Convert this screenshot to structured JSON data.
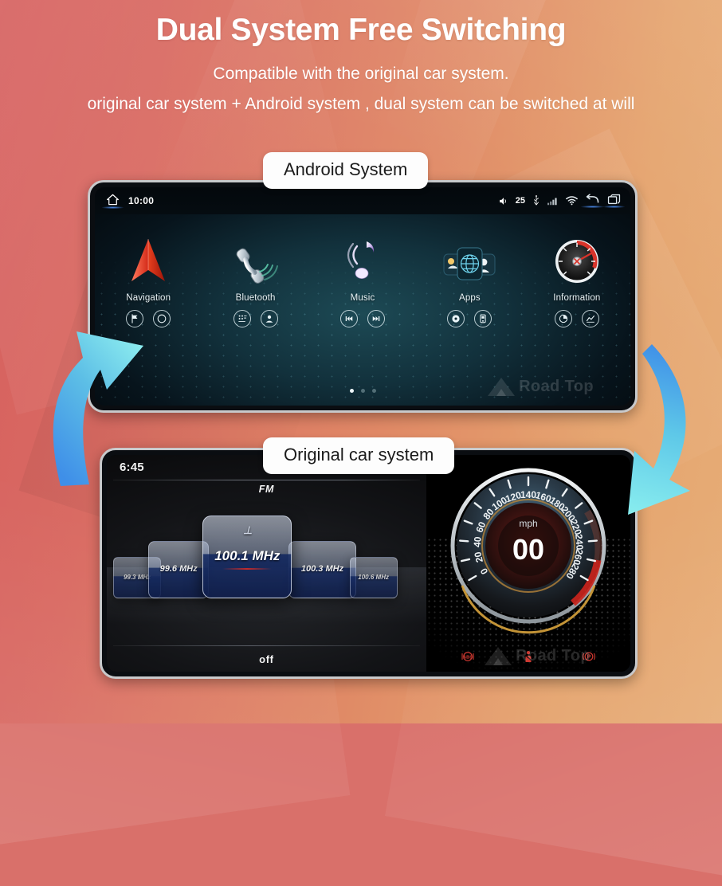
{
  "header": {
    "title": "Dual System Free Switching",
    "subtitle_1": "Compatible with the original car system.",
    "subtitle_2": "original car system + Android system , dual system can be switched at will"
  },
  "badges": {
    "android": "Android System",
    "original": "Original car system"
  },
  "android_screen": {
    "statusbar": {
      "home_icon": "home-icon",
      "time": "10:00",
      "volume": "25",
      "usb_icon": "usb-icon",
      "signal_icon": "signal-bars-icon",
      "wifi_icon": "wifi-icon",
      "back_icon": "back-arrow-icon",
      "recents_icon": "recent-apps-icon"
    },
    "apps": [
      {
        "label": "Navigation",
        "icon": "navigation-arrow-icon",
        "buttons": [
          "route-flag-icon",
          "map-pin-icon"
        ]
      },
      {
        "label": "Bluetooth",
        "icon": "phone-handset-icon",
        "buttons": [
          "dialpad-icon",
          "contact-icon"
        ]
      },
      {
        "label": "Music",
        "icon": "music-note-icon",
        "buttons": [
          "previous-track-icon",
          "next-track-icon"
        ]
      },
      {
        "label": "Apps",
        "icon": "app-tiles-globe-icon",
        "buttons": [
          "record-icon",
          "device-icon"
        ]
      },
      {
        "label": "Information",
        "icon": "gauge-icon",
        "buttons": [
          "pie-chart-icon",
          "chart-icon"
        ]
      }
    ],
    "page_dots": {
      "total": 3,
      "active": 1
    },
    "watermark": "Road Top"
  },
  "original_screen": {
    "radio": {
      "time": "6:45",
      "band": "FM",
      "power_state": "off",
      "stations": [
        {
          "freq": "99.3 MHz",
          "selected": false
        },
        {
          "freq": "99.6 MHz",
          "selected": false
        },
        {
          "freq": "100.1 MHz",
          "selected": true
        },
        {
          "freq": "100.3 MHz",
          "selected": false
        },
        {
          "freq": "100.6 MHz",
          "selected": false
        }
      ]
    },
    "cluster": {
      "unit": "mph",
      "speed": "00",
      "ticks": [
        "0",
        "20",
        "40",
        "60",
        "80",
        "100",
        "120",
        "140",
        "160",
        "180",
        "200",
        "220",
        "240",
        "260",
        "280"
      ],
      "redline_start": 200,
      "warnings": [
        "abs-warning-icon",
        "seatbelt-warning-icon",
        "parking-brake-icon"
      ]
    },
    "watermark": "Road Top"
  },
  "arrows": {
    "left": "curved-arrow-up-left",
    "right": "curved-arrow-down-right",
    "color_start": "#3f8fe8",
    "color_end": "#7fe3e8"
  },
  "colors": {
    "bg_left": "#d6605f",
    "bg_right": "#e7ad77",
    "accent_blue": "#4d8ff5",
    "warning_red": "#d93b33",
    "tile_blue": "#1a3068"
  }
}
